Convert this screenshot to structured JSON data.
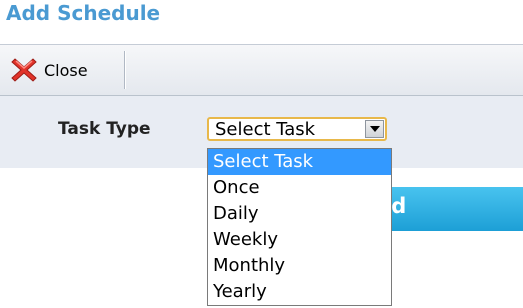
{
  "page": {
    "title": "Add Schedule"
  },
  "toolbar": {
    "close_label": "Close"
  },
  "form": {
    "task_type_label": "Task Type",
    "task_type_value": "Select Task"
  },
  "hidden_button": {
    "label_fragment": "ld"
  },
  "dropdown": {
    "options": [
      "Select Task",
      "Once",
      "Daily",
      "Weekly",
      "Monthly",
      "Yearly"
    ],
    "selected_index": 0
  },
  "colors": {
    "title": "#4a9ad2",
    "selection": "#3399ff",
    "button": "#1d9fd6",
    "select_border": "#e8b84a"
  },
  "icons": {
    "close": "red-x-icon",
    "arrow": "chevron-down-icon"
  }
}
